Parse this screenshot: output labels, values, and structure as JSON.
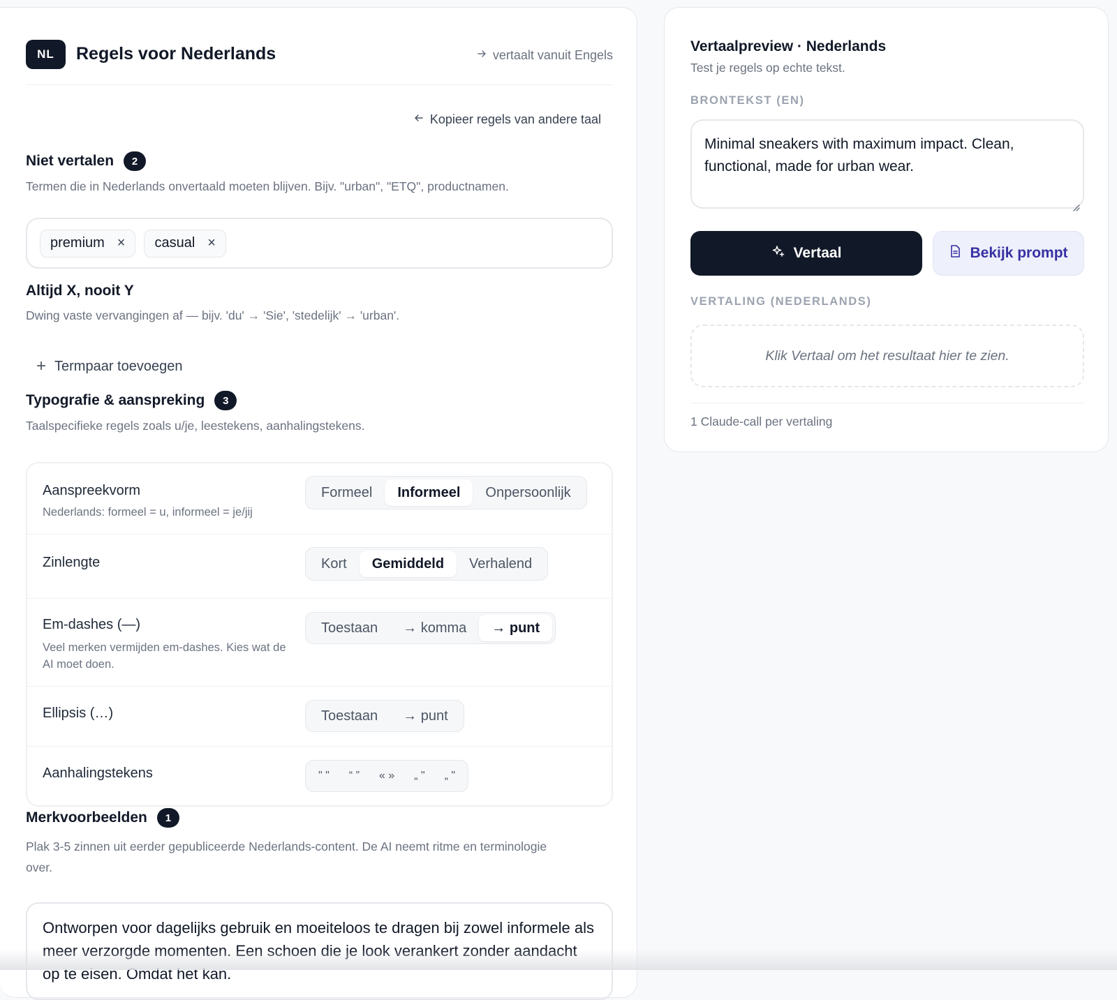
{
  "header": {
    "badge": "NL",
    "title": "Regels voor Nederlands",
    "translates_from": "vertaalt vanuit Engels"
  },
  "copy_rules_label": "Kopieer regels van andere taal",
  "do_not_translate": {
    "title": "Niet vertalen",
    "count": "2",
    "description": "Termen die in Nederlands onvertaald moeten blijven. Bijv. \"urban\", \"ETQ\", productnamen.",
    "tags": [
      "premium",
      "casual"
    ]
  },
  "always_never": {
    "title": "Altijd X, nooit Y",
    "description": "Dwing vaste vervangingen af — bijv. 'du' → 'Sie', 'stedelijk' → 'urban'.",
    "add_label": "Termpaar toevoegen"
  },
  "typography": {
    "title": "Typografie & aanspreking",
    "count": "3",
    "description": "Taalspecifieke regels zoals u/je, leestekens, aanhalingstekens.",
    "rows": [
      {
        "label": "Aanspreekvorm",
        "sub": "Nederlands: formeel = u, informeel = je/jij",
        "options": [
          "Formeel",
          "Informeel",
          "Onpersoonlijk"
        ],
        "selected": "Informeel"
      },
      {
        "label": "Zinlengte",
        "sub": "",
        "options": [
          "Kort",
          "Gemiddeld",
          "Verhalend"
        ],
        "selected": "Gemiddeld"
      },
      {
        "label": "Em-dashes (—)",
        "sub": "Veel merken vermijden em-dashes. Kies wat de AI moet doen.",
        "options": [
          "Toestaan",
          "→ komma",
          "→ punt"
        ],
        "selected": "→ punt"
      },
      {
        "label": "Ellipsis (…)",
        "sub": "",
        "options": [
          "Toestaan",
          "→ punt"
        ],
        "selected": ""
      },
      {
        "label": "Aanhalingstekens",
        "sub": "",
        "options": [
          "\" \"",
          "“ ”",
          "« »",
          "„ \"",
          "„ \""
        ],
        "selected": ""
      }
    ]
  },
  "brand_examples": {
    "title": "Merkvoorbeelden",
    "count": "1",
    "description": "Plak 3-5 zinnen uit eerder gepubliceerde Nederlands-content. De AI neemt ritme en terminologie over.",
    "text": "Ontworpen voor dagelijks gebruik en moeiteloos te dragen bij zowel informele als meer verzorgde momenten. Een schoen die je look verankert zonder aandacht op te eisen. Omdat het kan."
  },
  "preview": {
    "title": "Vertaalpreview · Nederlands",
    "subtitle": "Test je regels op echte tekst.",
    "source_label": "BRONTEKST (EN)",
    "source_text": "Minimal sneakers with maximum impact. Clean, functional, made for urban wear.",
    "translate_button": "Vertaal",
    "prompt_button": "Bekijk prompt",
    "result_label": "VERTALING (NEDERLANDS)",
    "result_placeholder": "Klik Vertaal om het resultaat hier te zien.",
    "footer": "1 Claude-call per vertaling"
  },
  "colors": {
    "dark": "#111827",
    "muted": "#6b7280",
    "border": "#e5e7eb",
    "accent_indigo": "#3730a3"
  }
}
